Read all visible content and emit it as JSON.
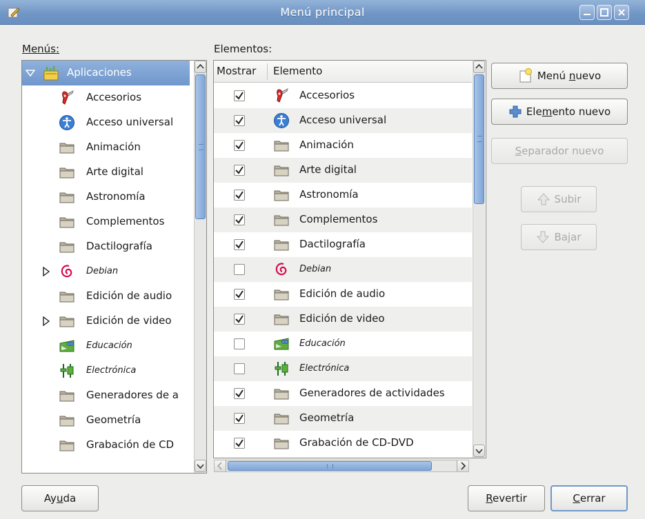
{
  "window": {
    "title": "Menú principal"
  },
  "labels": {
    "menus": "Menús:",
    "elements": "Elementos:"
  },
  "tree": {
    "items": [
      {
        "label": "Aplicaciones",
        "icon": "applications-icon",
        "italic": false,
        "expander": "expanded",
        "selected": true
      },
      {
        "label": "Accesorios",
        "icon": "accessories-knife-icon",
        "italic": false
      },
      {
        "label": "Acceso universal",
        "icon": "universal-access-icon",
        "italic": false
      },
      {
        "label": "Animación",
        "icon": "folder-icon",
        "italic": false
      },
      {
        "label": "Arte digital",
        "icon": "folder-icon",
        "italic": false
      },
      {
        "label": "Astronomía",
        "icon": "folder-icon",
        "italic": false
      },
      {
        "label": "Complementos",
        "icon": "folder-icon",
        "italic": false
      },
      {
        "label": "Dactilografía",
        "icon": "folder-icon",
        "italic": false
      },
      {
        "label": "Debian",
        "icon": "debian-swirl-icon",
        "italic": true,
        "expander": "collapsed"
      },
      {
        "label": "Edición de audio",
        "icon": "folder-icon",
        "italic": false
      },
      {
        "label": "Edición de video",
        "icon": "folder-icon",
        "italic": false,
        "expander": "collapsed"
      },
      {
        "label": "Educación",
        "icon": "education-icon",
        "italic": true
      },
      {
        "label": "Electrónica",
        "icon": "electronics-icon",
        "italic": true
      },
      {
        "label": "Generadores de a",
        "icon": "folder-icon",
        "italic": false
      },
      {
        "label": "Geometría",
        "icon": "folder-icon",
        "italic": false
      },
      {
        "label": "Grabación de CD",
        "icon": "folder-icon",
        "italic": false
      }
    ]
  },
  "elements": {
    "columns": {
      "show": "Mostrar",
      "element": "Elemento"
    },
    "rows": [
      {
        "checked": true,
        "label": "Accesorios",
        "icon": "accessories-knife-icon",
        "italic": false
      },
      {
        "checked": true,
        "label": "Acceso universal",
        "icon": "universal-access-icon",
        "italic": false
      },
      {
        "checked": true,
        "label": "Animación",
        "icon": "folder-icon",
        "italic": false
      },
      {
        "checked": true,
        "label": "Arte digital",
        "icon": "folder-icon",
        "italic": false
      },
      {
        "checked": true,
        "label": "Astronomía",
        "icon": "folder-icon",
        "italic": false
      },
      {
        "checked": true,
        "label": "Complementos",
        "icon": "folder-icon",
        "italic": false
      },
      {
        "checked": true,
        "label": "Dactilografía",
        "icon": "folder-icon",
        "italic": false
      },
      {
        "checked": false,
        "label": "Debian",
        "icon": "debian-swirl-icon",
        "italic": true
      },
      {
        "checked": true,
        "label": "Edición de audio",
        "icon": "folder-icon",
        "italic": false
      },
      {
        "checked": true,
        "label": "Edición de video",
        "icon": "folder-icon",
        "italic": false
      },
      {
        "checked": false,
        "label": "Educación",
        "icon": "education-icon",
        "italic": true
      },
      {
        "checked": false,
        "label": "Electrónica",
        "icon": "electronics-icon",
        "italic": true
      },
      {
        "checked": true,
        "label": "Generadores de actividades",
        "icon": "folder-icon",
        "italic": false
      },
      {
        "checked": true,
        "label": "Geometría",
        "icon": "folder-icon",
        "italic": false
      },
      {
        "checked": true,
        "label": "Grabación de CD-DVD",
        "icon": "folder-icon",
        "italic": false
      }
    ]
  },
  "buttons": {
    "new_menu": {
      "pre": "Menú ",
      "mnemonic": "n",
      "post": "uevo"
    },
    "new_item": {
      "pre": "Ele",
      "mnemonic": "m",
      "post": "ento nuevo"
    },
    "new_separator": {
      "pre": "",
      "mnemonic": "S",
      "post": "eparador nuevo"
    },
    "up": "Subir",
    "down": "Bajar",
    "help": {
      "pre": "Ay",
      "mnemonic": "u",
      "post": "da"
    },
    "revert": {
      "pre": "",
      "mnemonic": "R",
      "post": "evertir"
    },
    "close": {
      "pre": "",
      "mnemonic": "C",
      "post": "errar"
    }
  },
  "colors": {
    "titlebar": "#7a9dcb",
    "selection": "#7ea3d3",
    "accent": "#5c86bd"
  }
}
